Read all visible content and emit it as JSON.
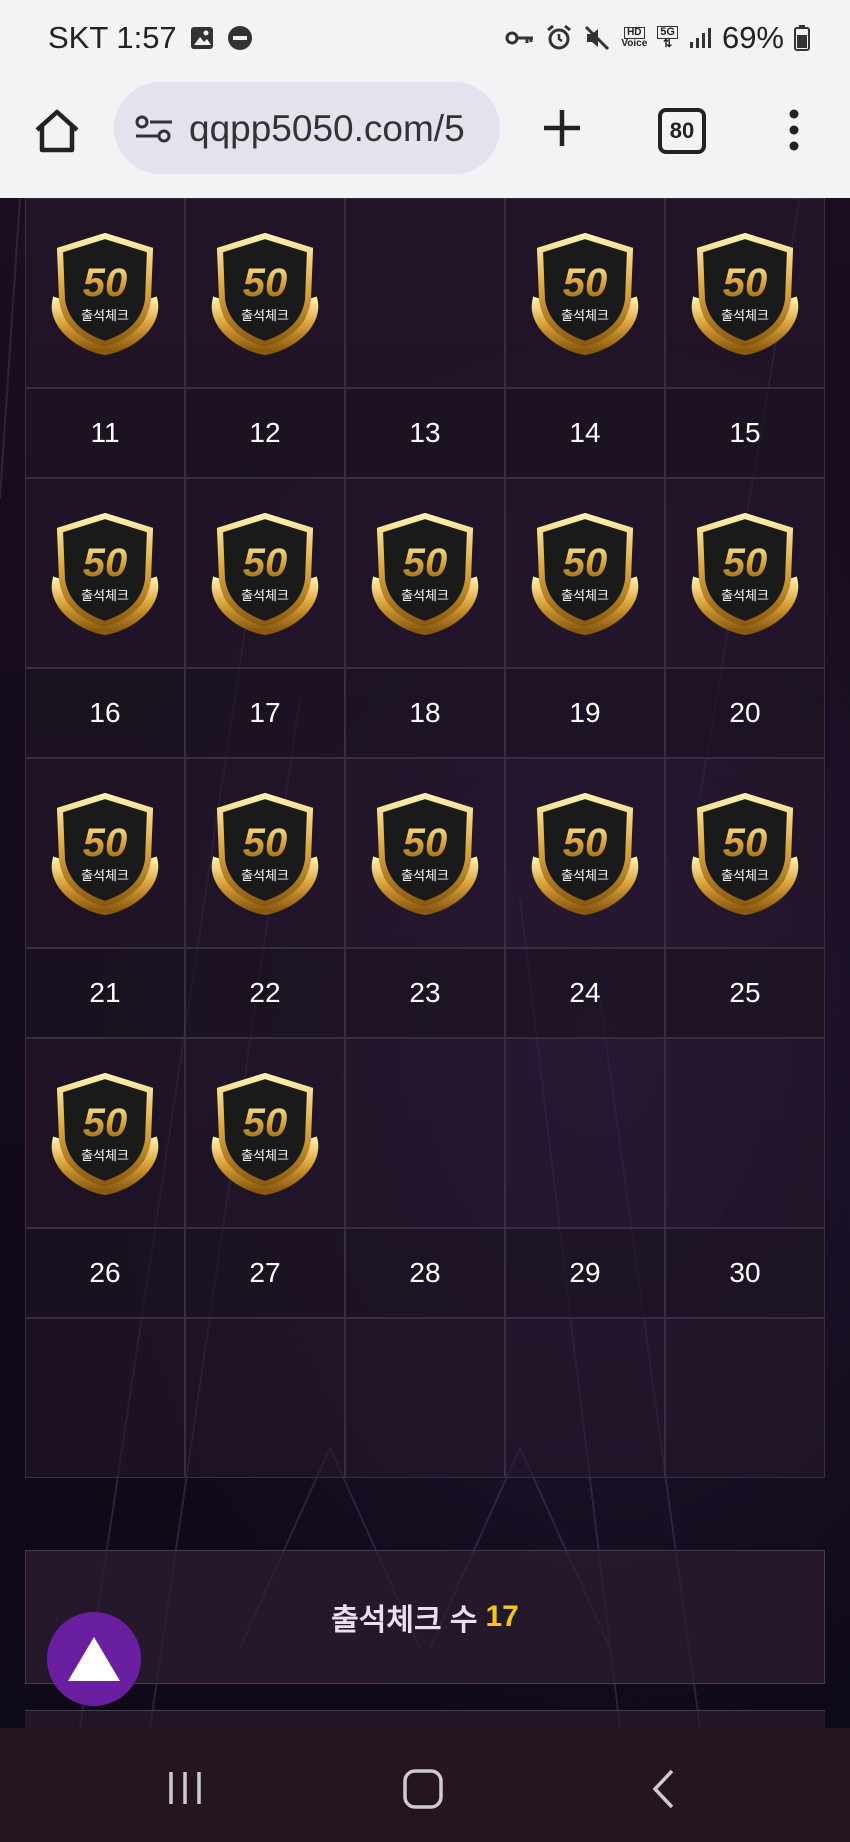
{
  "status_bar": {
    "carrier_time": "SKT 1:57",
    "battery": "69%",
    "hd_label": "HD",
    "voice_label": "Voice",
    "fiveg_label": "5G"
  },
  "browser": {
    "url": "qqpp5050.com/5",
    "tab_count": "80"
  },
  "calendar": {
    "badge_text": "50",
    "badge_caption": "출석체크",
    "rows": [
      {
        "icons": [
          true,
          true,
          false,
          true,
          true
        ],
        "numbers": [
          "11",
          "12",
          "13",
          "14",
          "15"
        ]
      },
      {
        "icons": [
          true,
          true,
          true,
          true,
          true
        ],
        "numbers": [
          "16",
          "17",
          "18",
          "19",
          "20"
        ]
      },
      {
        "icons": [
          true,
          true,
          true,
          true,
          true
        ],
        "numbers": [
          "21",
          "22",
          "23",
          "24",
          "25"
        ]
      },
      {
        "icons": [
          true,
          true,
          false,
          false,
          false
        ],
        "numbers": [
          "26",
          "27",
          "28",
          "29",
          "30"
        ]
      },
      {
        "icons": [
          false,
          false,
          false,
          false,
          false
        ],
        "numbers": []
      }
    ]
  },
  "summary": {
    "label": "출석체크 수",
    "count": "17"
  },
  "colors": {
    "accent_gold": "#f5c518",
    "scroll_button": "#6a1fa0"
  }
}
